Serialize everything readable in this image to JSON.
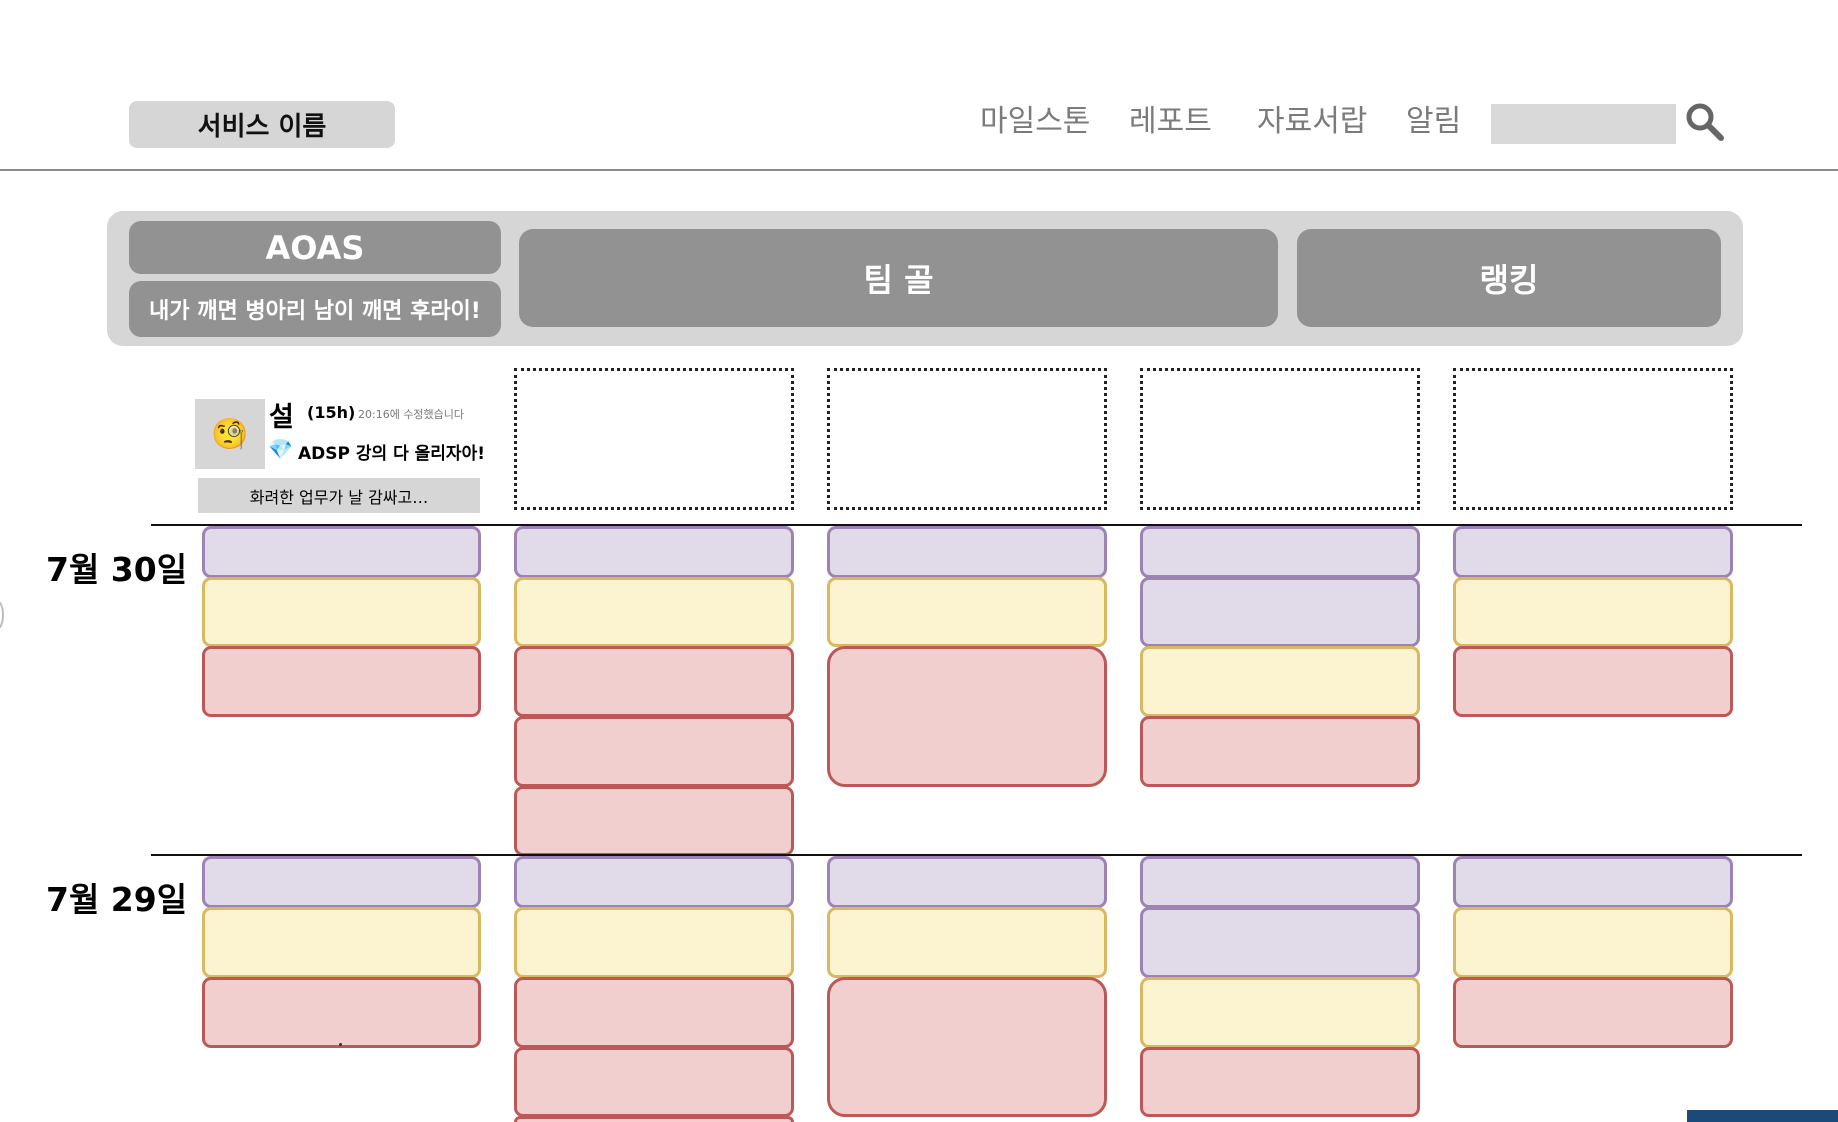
{
  "header": {
    "service_name": "서비스 이름",
    "nav": [
      "마일스톤",
      "레포트",
      "자료서랍",
      "알림"
    ],
    "search_placeholder": ""
  },
  "team": {
    "name": "AOAS",
    "motto": "내가 깨면 병아리 남이 깨면 후라이!",
    "goal_button": "팀 골",
    "ranking_button": "랭킹"
  },
  "member": {
    "avatar_icon": "🧐",
    "name": "설",
    "hours": "(15h)",
    "edited": "20:16에 수정했습니다",
    "goal_icon": "💎",
    "goal": "ADSP 강의 다 올리자아!",
    "status": "화려한 업무가 날 감싸고…"
  },
  "dates": [
    {
      "label": "7월 30일"
    },
    {
      "label": "7월 29일"
    }
  ],
  "colors": {
    "task_purple": "#e1dae8",
    "task_yellow": "#fcf3d1",
    "task_red": "#f1cfcf",
    "button_gray": "#929292",
    "band_gray": "#d6d6d6"
  }
}
